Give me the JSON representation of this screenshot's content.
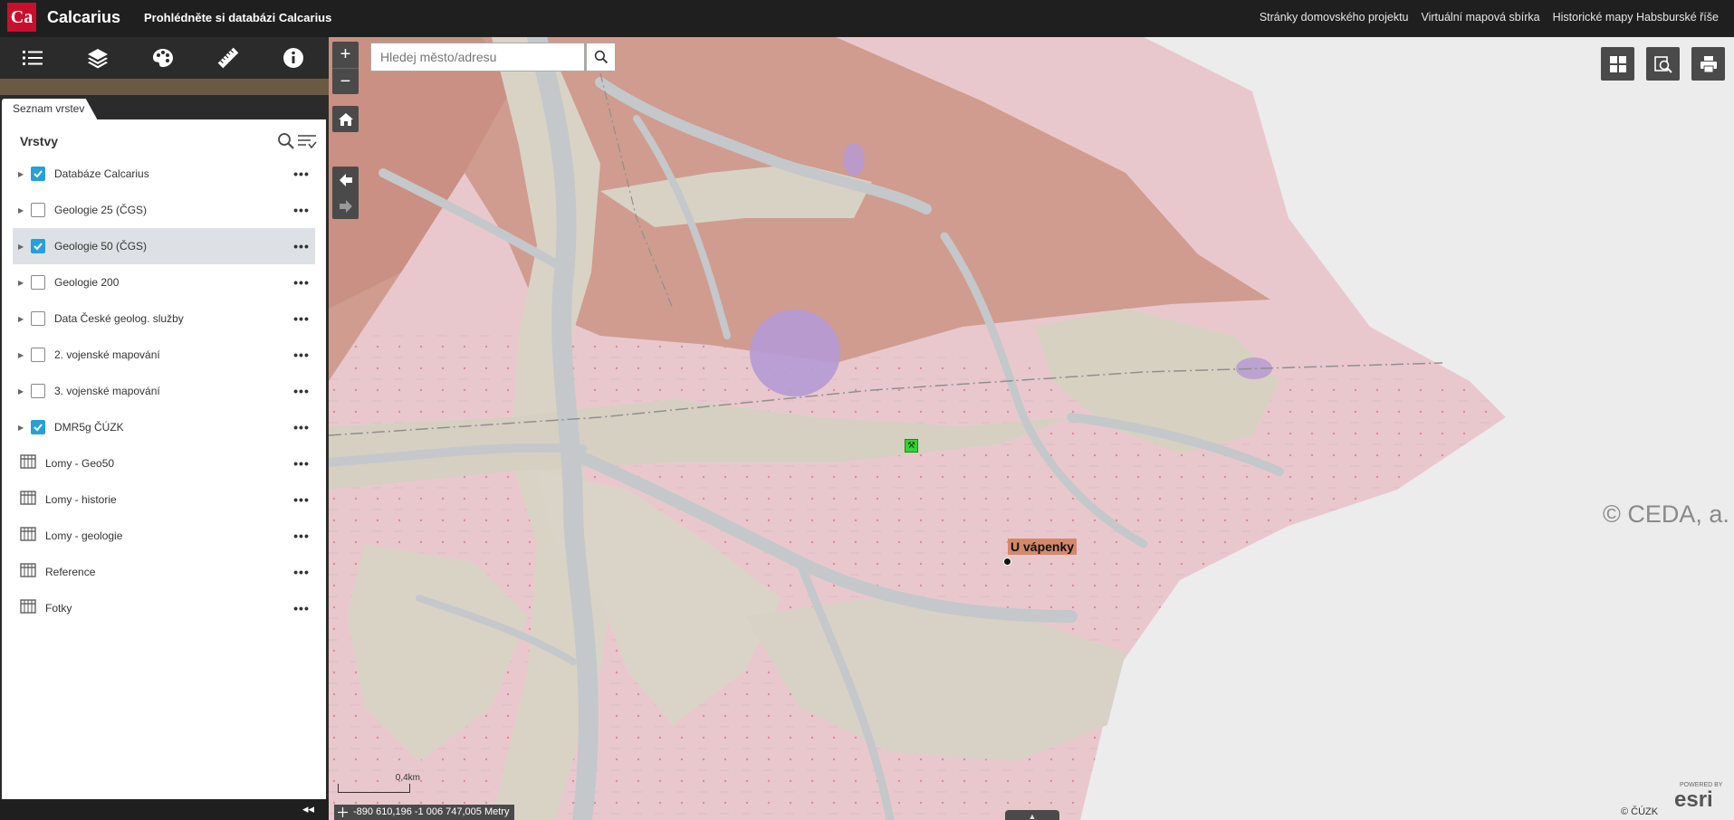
{
  "header": {
    "logo_text": "Ca",
    "title": "Calcarius",
    "subtitle": "Prohlédněte si databázi Calcarius",
    "links": [
      "Stránky domovského projektu",
      "Virtuální mapová sbírka",
      "Historické mapy Habsburské říše"
    ]
  },
  "toolbar": {
    "icons": [
      "list-icon",
      "layers-icon",
      "palette-icon",
      "ruler-icon",
      "info-icon"
    ]
  },
  "panel": {
    "tab_label": "Seznam vrstev",
    "title": "Vrstvy",
    "layers": [
      {
        "label": "Databáze Calcarius",
        "type": "group",
        "checked": true,
        "selected": false
      },
      {
        "label": "Geologie 25 (ČGS)",
        "type": "group",
        "checked": false,
        "selected": false
      },
      {
        "label": "Geologie 50 (ČGS)",
        "type": "group",
        "checked": true,
        "selected": true
      },
      {
        "label": "Geologie 200",
        "type": "group",
        "checked": false,
        "selected": false
      },
      {
        "label": "Data České geolog. služby",
        "type": "group",
        "checked": false,
        "selected": false
      },
      {
        "label": "2. vojenské mapování",
        "type": "group",
        "checked": false,
        "selected": false
      },
      {
        "label": "3. vojenské mapování",
        "type": "group",
        "checked": false,
        "selected": false
      },
      {
        "label": "DMR5g ČÚZK",
        "type": "group",
        "checked": true,
        "selected": false
      },
      {
        "label": "Lomy - Geo50",
        "type": "table",
        "checked": false,
        "selected": false
      },
      {
        "label": "Lomy - historie",
        "type": "table",
        "checked": false,
        "selected": false
      },
      {
        "label": "Lomy - geologie",
        "type": "table",
        "checked": false,
        "selected": false
      },
      {
        "label": "Reference",
        "type": "table",
        "checked": false,
        "selected": false
      },
      {
        "label": "Fotky",
        "type": "table",
        "checked": false,
        "selected": false
      }
    ],
    "more_label": "•••",
    "collapse_label": "◂◂"
  },
  "map": {
    "search_placeholder": "Hledej město/adresu",
    "zoom_in": "+",
    "zoom_out": "−",
    "watermark": "© CEDA, a. s",
    "place_label": "U vápenky",
    "scale_label": "0,4km",
    "coords": "-890 610,196 -1 006 747,005 Metry",
    "attribution": "© ČÚZK",
    "esri_powered": "POWERED BY",
    "esri": "esri",
    "bottom_tab": "▲"
  }
}
